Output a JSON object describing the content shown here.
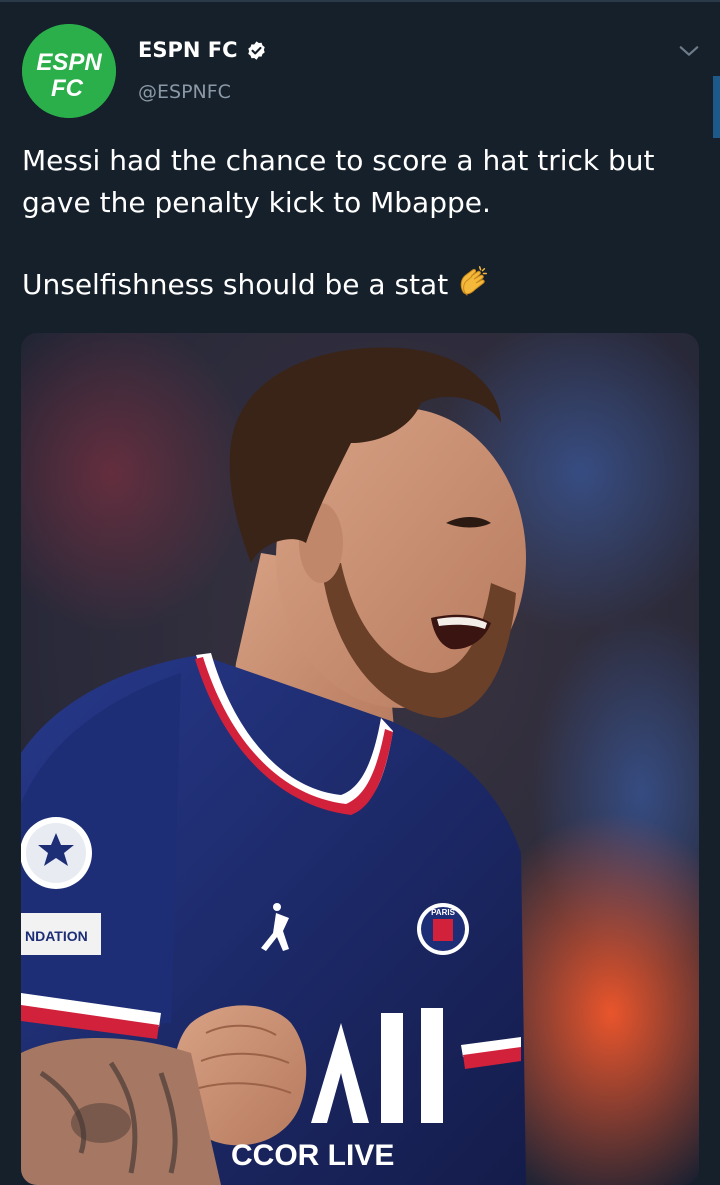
{
  "author": {
    "display_name": "ESPN FC",
    "handle": "@ESPNFC",
    "avatar_text_top": "ESPN",
    "avatar_text_bottom": "FC"
  },
  "tweet": {
    "line1": "Messi had the chance to score a hat trick but",
    "line2": "gave the penalty kick to Mbappe.",
    "line3": "Unselfishness should be a stat"
  },
  "media": {
    "shirt_text_bottom": "CCOR LIVE",
    "sleeve_patch_text": "NDATION",
    "crest_text": "PARIS"
  },
  "colors": {
    "background": "#15202b",
    "avatar_green": "#2aaf4a",
    "handle_gray": "#8b98a5",
    "shirt_navy": "#1f2d6b"
  },
  "icons": [
    "verified-icon",
    "chevron-down-icon",
    "clapping-hands-icon"
  ]
}
